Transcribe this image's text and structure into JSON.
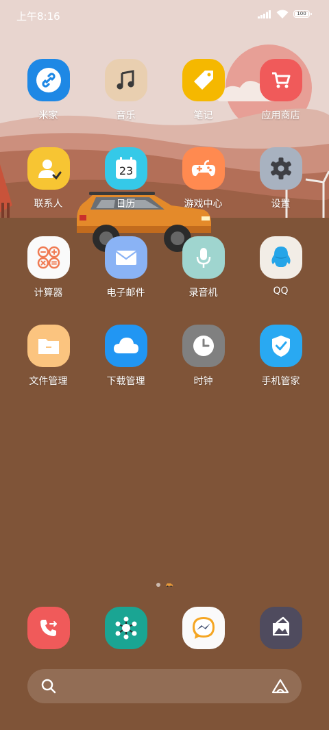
{
  "status_bar": {
    "time": "上午8:16",
    "battery_level": "100",
    "icons": [
      "signal-icon",
      "wifi-icon",
      "battery-icon"
    ]
  },
  "apps": [
    {
      "name": "米家",
      "icon": "link-icon",
      "color": "#1e88e5"
    },
    {
      "name": "音乐",
      "icon": "music-note-icon",
      "color": "#e9cfb0"
    },
    {
      "name": "笔记",
      "icon": "tag-icon",
      "color": "#f5b800"
    },
    {
      "name": "应用商店",
      "icon": "shopping-cart-icon",
      "color": "#f05a5a"
    },
    {
      "name": "联系人",
      "icon": "contact-icon",
      "color": "#f7c533"
    },
    {
      "name": "日历",
      "icon": "calendar-icon",
      "color": "#35c9e8",
      "calendar_day": "23"
    },
    {
      "name": "游戏中心",
      "icon": "gamepad-icon",
      "color": "#ff8a50"
    },
    {
      "name": "设置",
      "icon": "gear-icon",
      "color": "#a8b2c0"
    },
    {
      "name": "计算器",
      "icon": "calculator-icon",
      "color": "#fafafa"
    },
    {
      "name": "电子邮件",
      "icon": "mail-icon",
      "color": "#8ab3f5"
    },
    {
      "name": "录音机",
      "icon": "microphone-icon",
      "color": "#9fd5cf"
    },
    {
      "name": "QQ",
      "icon": "qq-penguin-icon",
      "color": "#f2ede6"
    },
    {
      "name": "文件管理",
      "icon": "folder-icon",
      "color": "#fbc47f"
    },
    {
      "name": "下载管理",
      "icon": "cloud-icon",
      "color": "#2196f3"
    },
    {
      "name": "时钟",
      "icon": "clock-icon",
      "color": "#808080"
    },
    {
      "name": "手机管家",
      "icon": "shield-check-icon",
      "color": "#29a9f2"
    }
  ],
  "dock": [
    {
      "icon": "phone-icon",
      "color": "#f05a5a"
    },
    {
      "icon": "network-hub-icon",
      "color": "#1aa593"
    },
    {
      "icon": "messenger-icon",
      "color": "#fafafa"
    },
    {
      "icon": "gallery-icon",
      "color": "#4f4b5e"
    }
  ],
  "page_indicator": {
    "pages": 2,
    "current": 2
  },
  "search_bar": {
    "icons": [
      "search-icon",
      "assistant-icon"
    ]
  }
}
